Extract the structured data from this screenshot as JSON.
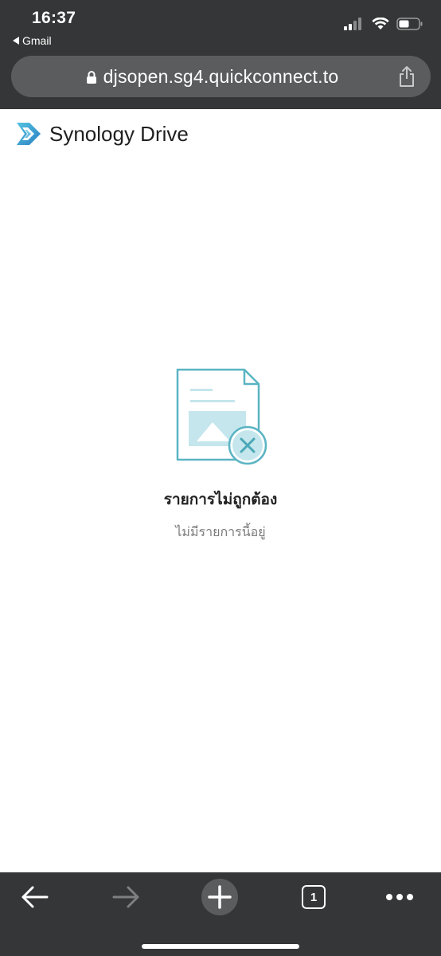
{
  "status_bar": {
    "time": "16:37",
    "back_app": "Gmail"
  },
  "browser": {
    "url": "djsopen.sg4.quickconnect.to",
    "tab_count": "1"
  },
  "app": {
    "title": "Synology Drive",
    "brand_color": "#3aa0c8"
  },
  "empty_state": {
    "title": "รายการไม่ถูกต้อง",
    "subtitle": "ไม่มีรายการนี้อยู่",
    "accent_color": "#5ab4c3"
  },
  "icons": {
    "lock": "lock-icon",
    "share": "share-icon",
    "back": "arrow-left-icon",
    "forward": "arrow-right-icon",
    "new_tab": "plus-icon",
    "more": "more-dots-icon"
  }
}
